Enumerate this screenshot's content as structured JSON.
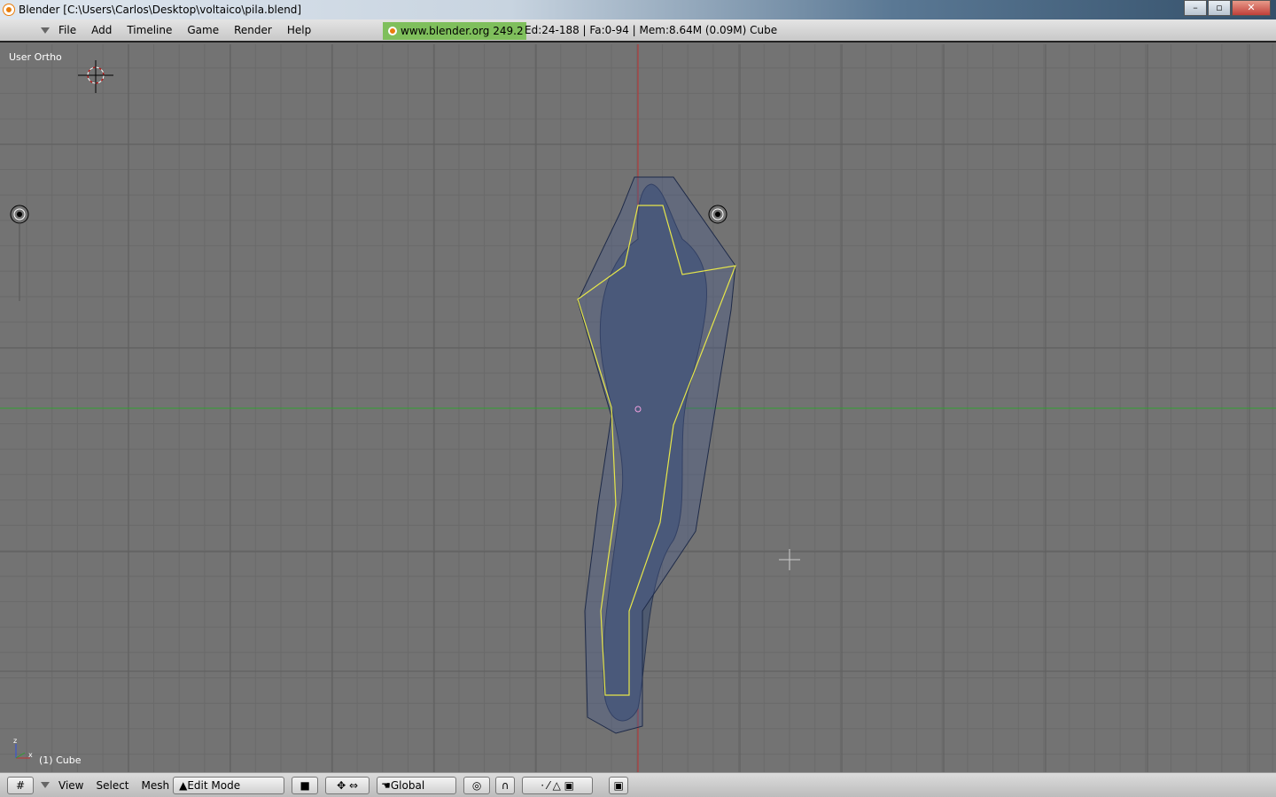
{
  "window": {
    "title": "Blender [C:\\Users\\Carlos\\Desktop\\voltaico\\pila.blend]",
    "buttons": [
      "minimize",
      "maximize",
      "close"
    ]
  },
  "menubar": {
    "items": [
      "File",
      "Add",
      "Timeline",
      "Game",
      "Render",
      "Help"
    ],
    "version_badge": "www.blender.org 249.2",
    "stats": "Ed:24-188 | Fa:0-94 | Mem:8.64M (0.09M) Cube"
  },
  "viewport": {
    "view_label": "User Ortho",
    "object_label": "(1) Cube",
    "axis_z": "z",
    "axis_x": "x"
  },
  "footer": {
    "menus": [
      "View",
      "Select",
      "Mesh"
    ],
    "mode": "Edit Mode",
    "orientation": "Global"
  },
  "colors": {
    "viewport_bg": "#737373",
    "selected_edges": "#e6e64a",
    "x_axis": "#c03030",
    "y_axis": "#30a030"
  }
}
